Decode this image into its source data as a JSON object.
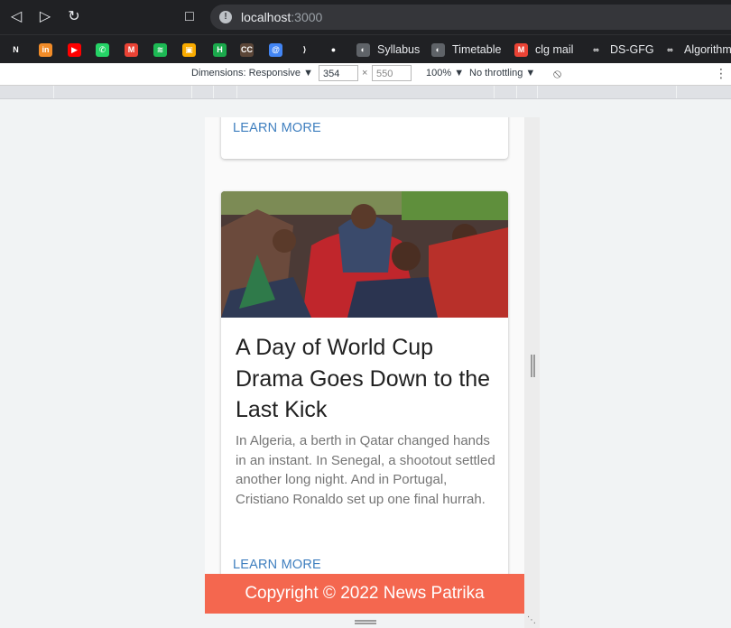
{
  "browser": {
    "url_host": "localhost",
    "url_port": ":3000",
    "bookmarks": [
      {
        "label": "",
        "icon": "notion-icon",
        "color": "#202124",
        "glyph": "N"
      },
      {
        "label": "",
        "icon": "unstop-icon",
        "color": "#f28c28",
        "glyph": "in"
      },
      {
        "label": "",
        "icon": "youtube-music-icon",
        "color": "#ff0000",
        "glyph": "▶"
      },
      {
        "label": "",
        "icon": "whatsapp-icon",
        "color": "#25d366",
        "glyph": "✆"
      },
      {
        "label": "",
        "icon": "gmail-icon",
        "color": "#ea4335",
        "glyph": "M"
      },
      {
        "label": "",
        "icon": "spotify-icon",
        "color": "#1db954",
        "glyph": "≋"
      },
      {
        "label": "",
        "icon": "classroom-icon",
        "color": "#f9ab00",
        "glyph": "▣"
      },
      {
        "label": "",
        "icon": "hackerrank-icon",
        "color": "#1ba94c",
        "glyph": "H"
      },
      {
        "label": "",
        "icon": "codechef-icon",
        "color": "#5b4638",
        "glyph": "CC"
      },
      {
        "label": "",
        "icon": "leetcode-blue-icon",
        "color": "#4285f4",
        "glyph": "@"
      },
      {
        "label": "",
        "icon": "leetcode-icon",
        "color": "#202124",
        "glyph": "⟩"
      },
      {
        "label": "",
        "icon": "github-icon",
        "color": "#202124",
        "glyph": "●"
      },
      {
        "label": "Syllabus",
        "icon": "globe-icon",
        "color": "#5f6368",
        "glyph": "◐"
      },
      {
        "label": "Timetable",
        "icon": "globe-icon",
        "color": "#5f6368",
        "glyph": "◐"
      },
      {
        "label": "clg mail",
        "icon": "gmail-icon",
        "color": "#ea4335",
        "glyph": "M"
      },
      {
        "label": "DS-GFG",
        "icon": "gfg-icon",
        "color": "#202124",
        "glyph": "∞"
      },
      {
        "label": "Algorithm",
        "icon": "gfg-icon",
        "color": "#202124",
        "glyph": "∞"
      }
    ]
  },
  "devtools": {
    "dimensions_label": "Dimensions: Responsive ▼",
    "width_value": "354",
    "times": "×",
    "height_value": "550",
    "zoom": "100% ▼",
    "throttling": "No throttling ▼",
    "rotate_icon": "⦸",
    "more_icon": "⋮"
  },
  "page": {
    "card1_link": "LEARN MORE",
    "card2": {
      "title": "A Day of World Cup Drama Goes Down to the Last Kick",
      "description": "In Algeria, a berth in Qatar changed hands in an instant. In Senegal, a shootout settled another long night. And in Portugal, Cristiano Ronaldo set up one final hurrah.",
      "link": "LEARN MORE"
    },
    "footer": "Copyright © 2022 News Patrika"
  },
  "colors": {
    "footer_bg": "#f4674f",
    "link": "#3f7fbf"
  }
}
